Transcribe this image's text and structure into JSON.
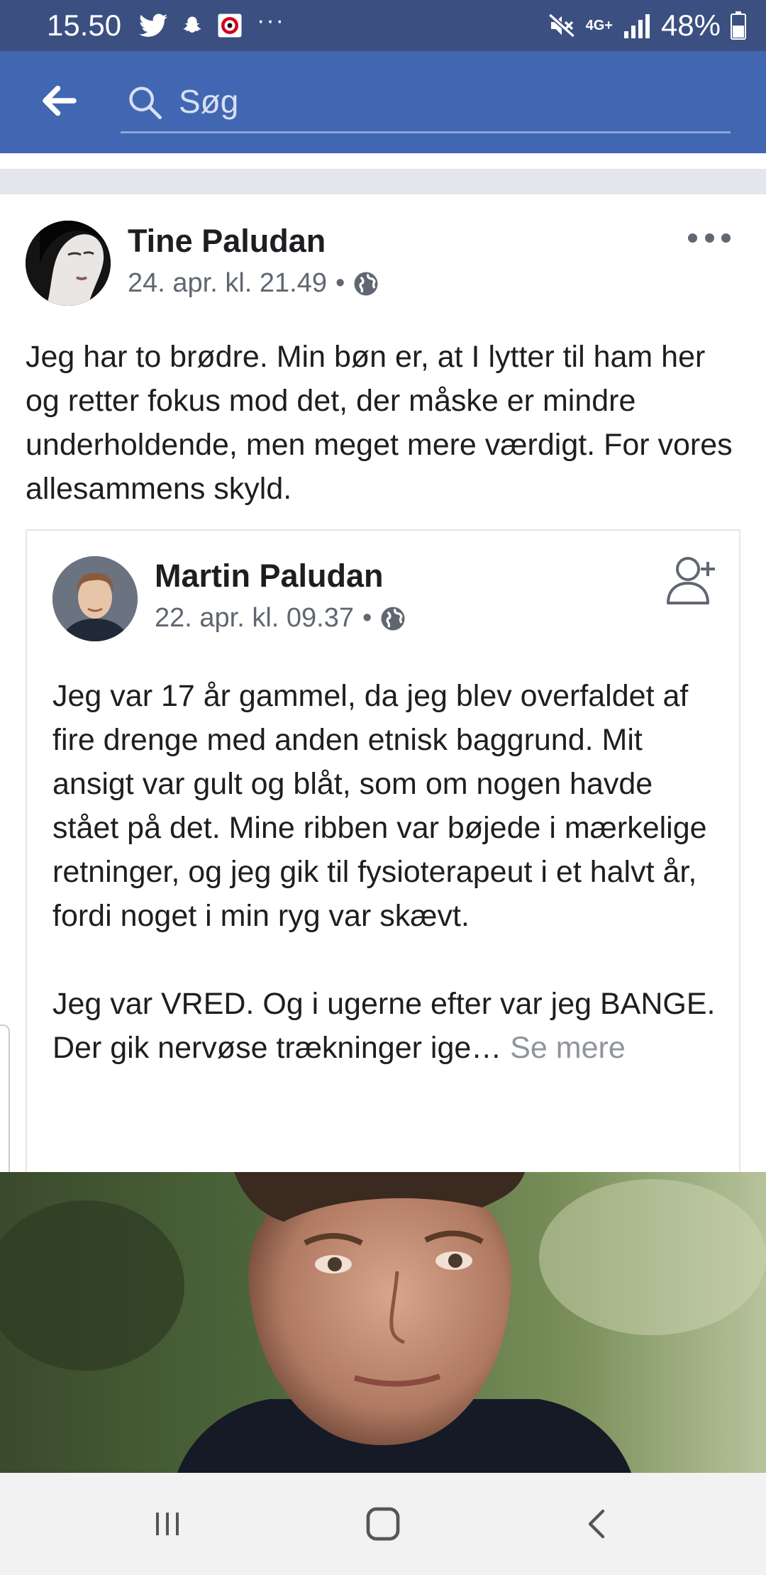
{
  "status_bar": {
    "time": "15.50",
    "overflow": "···",
    "network": "4G+",
    "battery": "48%",
    "icons": [
      "twitter-icon",
      "snapchat-icon",
      "app-notification-icon",
      "mute-icon",
      "signal-icon",
      "battery-icon"
    ]
  },
  "header": {
    "search_placeholder": "Søg",
    "accent_color": "#4267b2"
  },
  "post": {
    "author": "Tine Paludan",
    "timestamp": "24. apr. kl. 21.49",
    "separator": "•",
    "text": "Jeg har to brødre. Min bøn er, at I lytter til ham her og retter fokus mod det, der måske er mindre underholdende, men meget mere værdigt. For vores allesammens skyld."
  },
  "shared_post": {
    "author": "Martin Paludan",
    "timestamp": "22. apr. kl. 09.37",
    "separator": "•",
    "paragraph1": "Jeg var 17 år gammel, da jeg blev overfaldet af fire drenge med anden etnisk baggrund. Mit ansigt var gult og blåt, som om nogen havde stået på det. Mine ribben var bøjede i mærkelige retninger, og jeg gik til fysioterapeut i et halvt år, fordi noget i min ryg var skævt.",
    "paragraph2": "Jeg var VRED. Og i ugerne efter var jeg BANGE. Der gik nervøse trækninger ige…",
    "see_more": "Se mere"
  },
  "nav_bar": {
    "buttons": [
      "recents-icon",
      "home-icon",
      "back-icon"
    ]
  }
}
